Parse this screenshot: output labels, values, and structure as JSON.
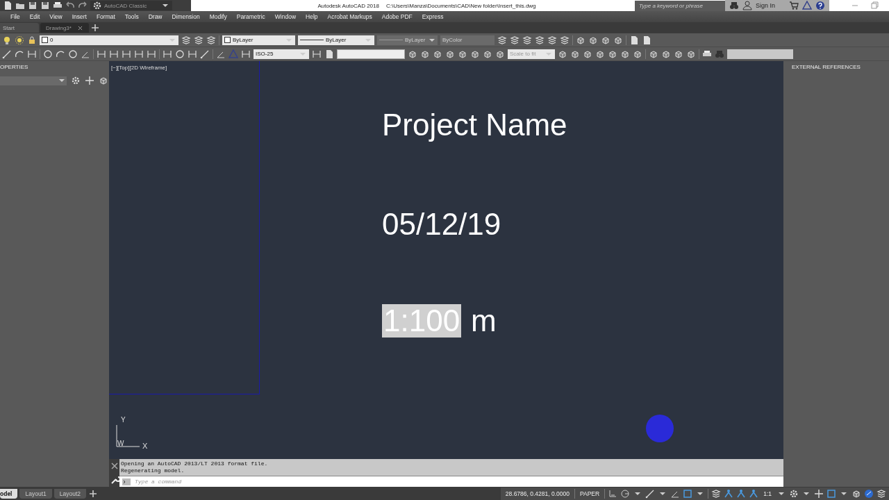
{
  "quick_access": {
    "workspace": "AutoCAD Classic"
  },
  "window": {
    "title": "Autodesk AutoCAD 2018",
    "path": "C:\\Users\\Manza\\Documents\\CAD\\New folder\\Insert_this.dwg"
  },
  "search": {
    "placeholder": "Type a keyword or phrase"
  },
  "account": {
    "label": "Sign In"
  },
  "menu": [
    "File",
    "Edit",
    "View",
    "Insert",
    "Format",
    "Tools",
    "Draw",
    "Dimension",
    "Modify",
    "Parametric",
    "Window",
    "Help",
    "Acrobat Markups",
    "Adobe PDF",
    "Express"
  ],
  "file_tabs": [
    {
      "label": "Start",
      "selected": false,
      "closable": false
    },
    {
      "label": "Drawing3*",
      "selected": true,
      "closable": true
    }
  ],
  "properties_toolbar": {
    "layer": "0",
    "color_control": "ByLayer",
    "linetype": "ByLayer",
    "lineweight": "ByLayer",
    "plot_style": "ByColor"
  },
  "styles_toolbar": {
    "dim_style": "ISO-25",
    "scale": "Scale to fit"
  },
  "left_panel": {
    "title": "OPERTIES"
  },
  "right_panel": {
    "title": "EXTERNAL REFERENCES"
  },
  "viewport": {
    "label": "[−][Top][2D Wireframe]",
    "title": "Project Name",
    "date": "05/12/19",
    "scale": {
      "value": "1:100",
      "unit": "m",
      "highlighted": true
    },
    "ucs": {
      "y": "Y",
      "w": "W",
      "x": "X"
    }
  },
  "command_line": {
    "history": [
      "Opening an AutoCAD 2013/LT 2013 format file.",
      "Regenerating model."
    ],
    "placeholder": "Type a command"
  },
  "layout_tabs": [
    {
      "label": "odel",
      "selected": true
    },
    {
      "label": "Layout1",
      "selected": false
    },
    {
      "label": "Layout2",
      "selected": false
    }
  ],
  "status_bar": {
    "coordinates": "28.6786, 0.4281, 0.0000",
    "space": "PAPER",
    "annotation_scale": "1:1"
  }
}
